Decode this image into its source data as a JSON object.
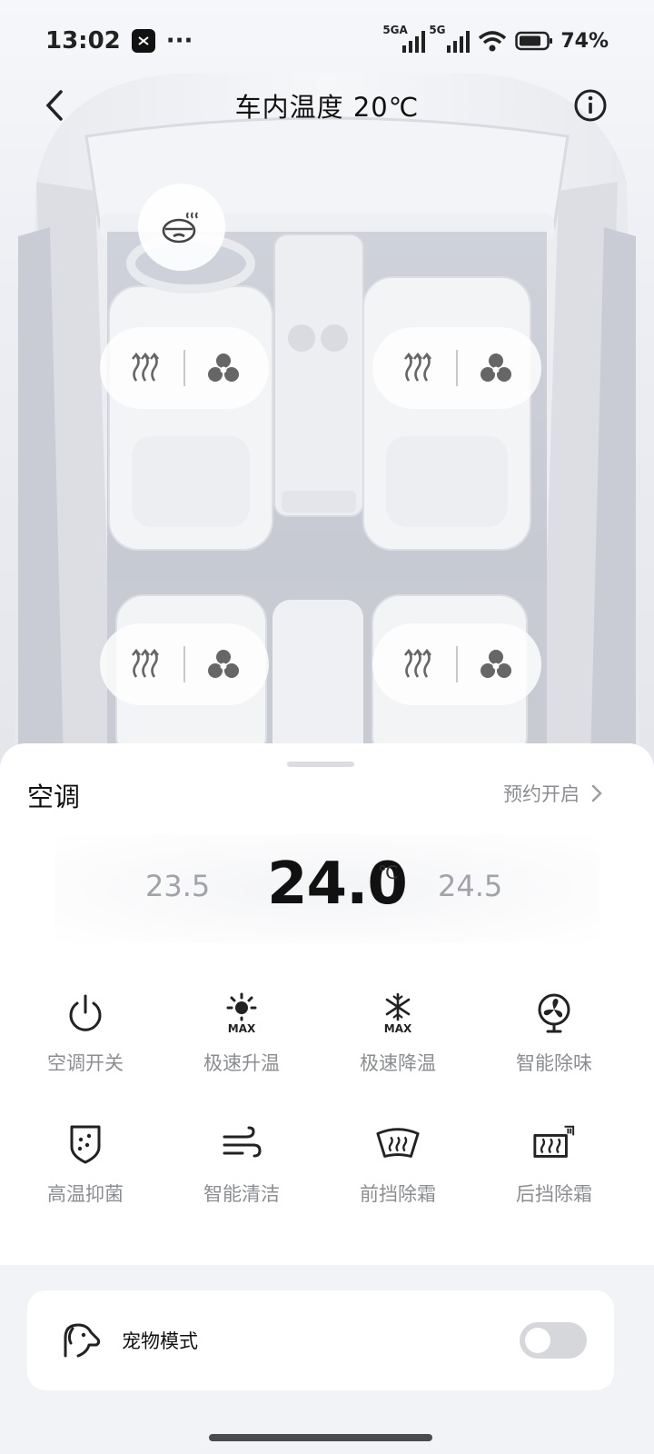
{
  "status_bar": {
    "time": "13:02",
    "more": "···",
    "network1": "5GA",
    "network2": "5G",
    "battery": "74%"
  },
  "header": {
    "title": "车内温度 20℃"
  },
  "seats": [
    {
      "position": "front-left",
      "icons": [
        "seat-heat-icon",
        "seat-fan-icon"
      ]
    },
    {
      "position": "front-right",
      "icons": [
        "seat-heat-icon",
        "seat-fan-icon"
      ]
    },
    {
      "position": "rear-left",
      "icons": [
        "seat-heat-icon",
        "seat-fan-icon"
      ]
    },
    {
      "position": "rear-right",
      "icons": [
        "seat-heat-icon",
        "seat-fan-icon"
      ]
    }
  ],
  "ac": {
    "title": "空调",
    "schedule_label": "预约开启",
    "temp_prev": "23.5",
    "temp_current": "24.0",
    "temp_next": "24.5",
    "temp_unit": "℃"
  },
  "functions": [
    {
      "label": "空调开关",
      "icon": "power-icon"
    },
    {
      "label": "极速升温",
      "icon": "sun-max-icon"
    },
    {
      "label": "极速降温",
      "icon": "snow-max-icon"
    },
    {
      "label": "智能除味",
      "icon": "fan-icon"
    },
    {
      "label": "高温抑菌",
      "icon": "shield-icon"
    },
    {
      "label": "智能清洁",
      "icon": "wind-icon"
    },
    {
      "label": "前挡除霜",
      "icon": "front-defrost-icon"
    },
    {
      "label": "后挡除霜",
      "icon": "rear-defrost-icon"
    }
  ],
  "pet_mode": {
    "label": "宠物模式",
    "enabled": false
  },
  "colors": {
    "accent": "#111111",
    "muted_text": "#8b8d92",
    "background": "#eef0f4"
  }
}
